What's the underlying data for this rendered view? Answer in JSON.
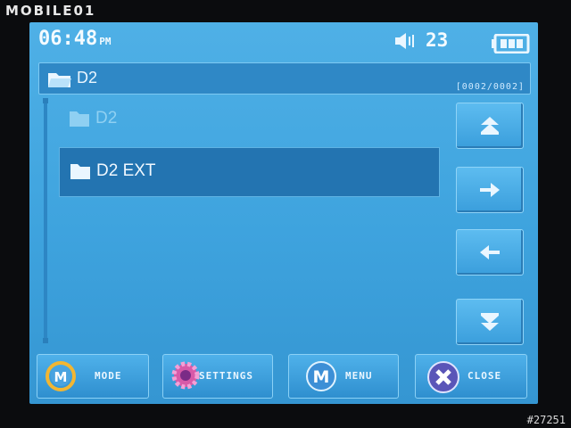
{
  "watermark": "MOBILE01",
  "photo_id": "#27251",
  "status": {
    "time": "06:48",
    "ampm": "PM",
    "volume": "23"
  },
  "path": {
    "current_folder": "D2",
    "counter": "[0002/0002]"
  },
  "files": [
    {
      "name": "D2",
      "state": "normal"
    },
    {
      "name": "D2 EXT",
      "state": "selected"
    }
  ],
  "bottom_buttons": {
    "mode": "MODE",
    "settings": "SETTINGS",
    "menu": "MENU",
    "close": "CLOSE"
  },
  "colors": {
    "screen_bg": "#3ea3de",
    "selection": "#2374b1",
    "text": "#f0f8ff"
  },
  "icons": [
    "folder-open-icon",
    "folder-icon",
    "speaker-icon",
    "battery-icon",
    "page-up-icon",
    "enter-icon",
    "back-icon",
    "page-down-icon",
    "mode-icon",
    "gear-icon",
    "menu-m-icon",
    "close-x-icon"
  ]
}
